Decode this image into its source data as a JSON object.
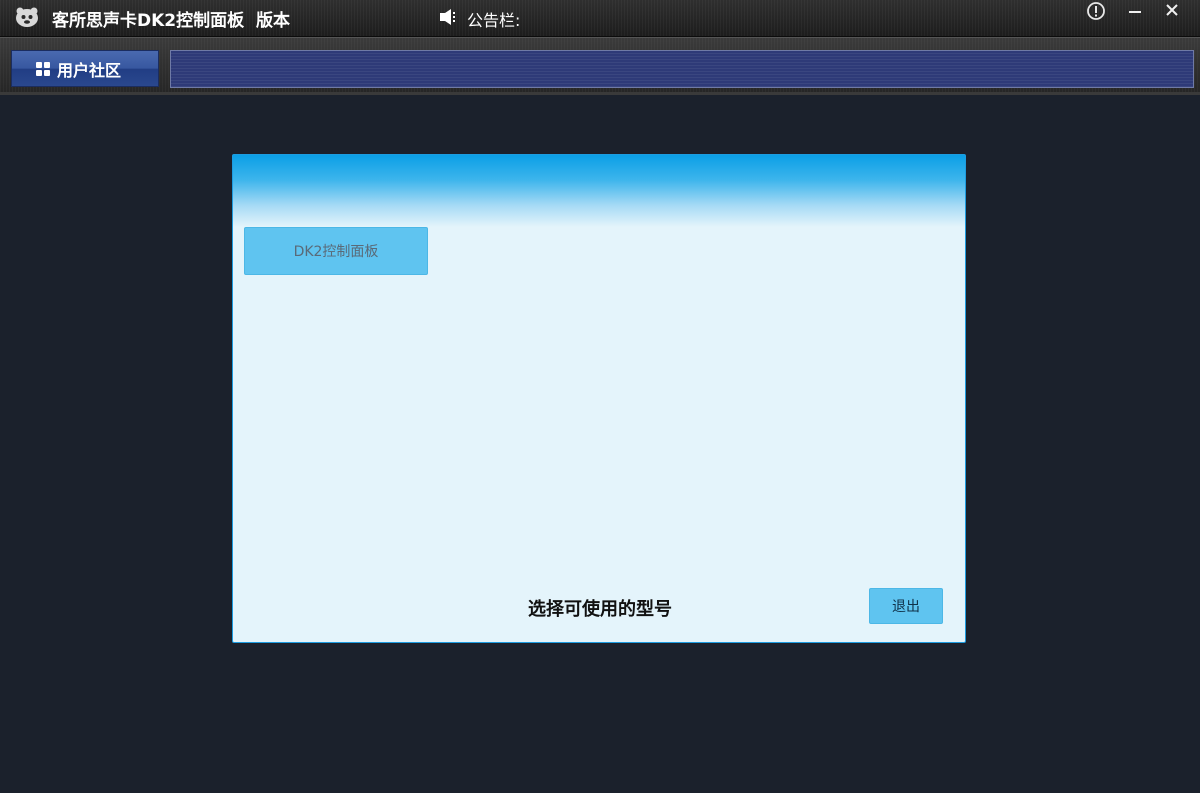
{
  "titlebar": {
    "app_title": "客所思声卡DK2控制面板  版本",
    "notice_label": "公告栏:",
    "icons": [
      "app-logo-icon",
      "speaker-icon",
      "info-icon",
      "minimize-icon",
      "close-icon"
    ]
  },
  "toolbar": {
    "community_label": "用户社区",
    "marquee_text": ""
  },
  "dialog": {
    "model_button_label": "DK2控制面板",
    "caption": "选择可使用的型号",
    "exit_label": "退出"
  },
  "colors": {
    "background": "#1b212c",
    "dialog_bg": "#e4f4fb",
    "accent_blue": "#0b9fe6",
    "button_blue": "#5fc4f0",
    "community_button": "#2a488e",
    "marquee_bg": "#2e3a78"
  }
}
